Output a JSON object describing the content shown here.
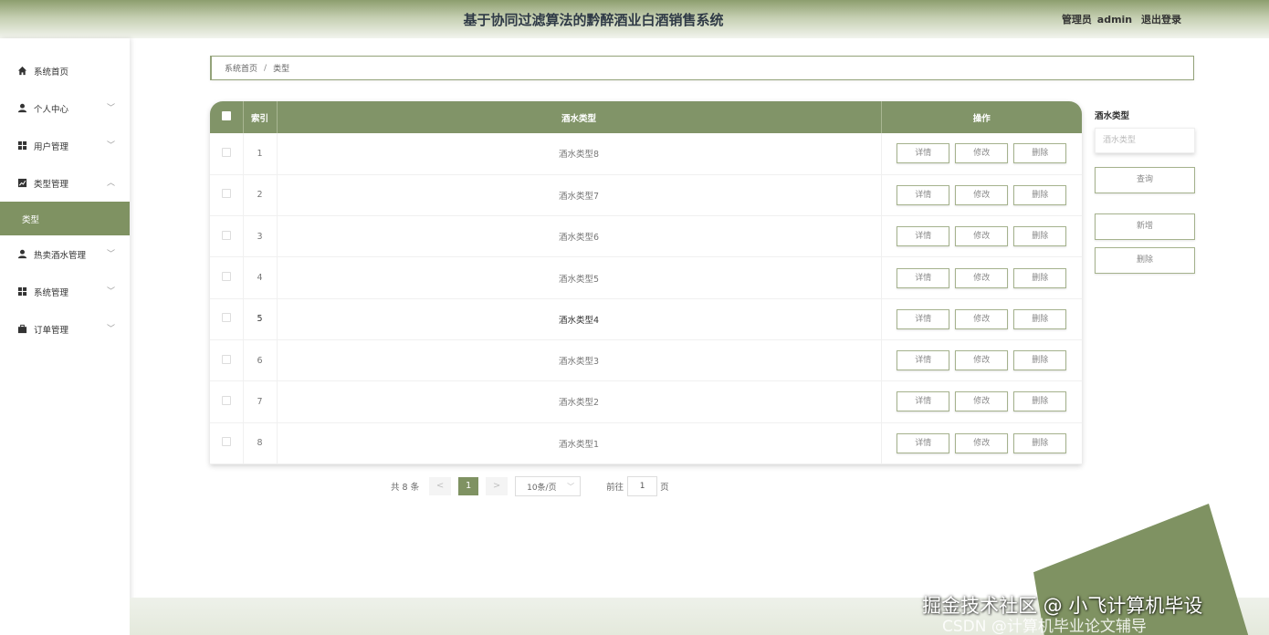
{
  "header": {
    "title": "基于协同过滤算法的黔醉酒业白酒销售系统",
    "user_role": "管理员",
    "user_name": "admin",
    "logout_label": "退出登录"
  },
  "sidebar": {
    "items": [
      {
        "label": "系统首页",
        "icon": "home-icon"
      },
      {
        "label": "个人中心",
        "icon": "user-icon",
        "chevron": "﹀"
      },
      {
        "label": "用户管理",
        "icon": "grid-icon",
        "chevron": "﹀"
      },
      {
        "label": "类型管理",
        "icon": "chart-icon",
        "chevron": "︿"
      },
      {
        "label": "热卖酒水管理",
        "icon": "user-icon",
        "chevron": "﹀"
      },
      {
        "label": "系统管理",
        "icon": "grid-icon",
        "chevron": "﹀"
      },
      {
        "label": "订单管理",
        "icon": "briefcase-icon",
        "chevron": "﹀"
      }
    ],
    "active_sub": "类型"
  },
  "breadcrumb": {
    "home": "系统首页",
    "sep": "/",
    "current": "类型"
  },
  "table": {
    "headers": {
      "index": "索引",
      "type": "酒水类型",
      "ops": "操作"
    },
    "rows": [
      {
        "index": "1",
        "type": "酒水类型8"
      },
      {
        "index": "2",
        "type": "酒水类型7"
      },
      {
        "index": "3",
        "type": "酒水类型6"
      },
      {
        "index": "4",
        "type": "酒水类型5"
      },
      {
        "index": "5",
        "type": "酒水类型4"
      },
      {
        "index": "6",
        "type": "酒水类型3"
      },
      {
        "index": "7",
        "type": "酒水类型2"
      },
      {
        "index": "8",
        "type": "酒水类型1"
      }
    ],
    "op_labels": {
      "detail": "详情",
      "edit": "修改",
      "delete": "删除"
    }
  },
  "search": {
    "label": "酒水类型",
    "placeholder": "酒水类型",
    "query_button": "查询",
    "add_button": "新增",
    "delete_button": "删除"
  },
  "pagination": {
    "total": "共 8 条",
    "prev": "<",
    "current_page": "1",
    "next": ">",
    "page_size": "10条/页",
    "goto_prefix": "前往",
    "goto_value": "1",
    "goto_suffix": "页"
  },
  "watermark": {
    "line1": "掘金技术社区 @ 小飞计算机毕设",
    "line2": "CSDN @计算机毕业论文辅导"
  },
  "colors": {
    "accent": "#7f9262",
    "header_gradient_top": "#8d9e6e"
  }
}
